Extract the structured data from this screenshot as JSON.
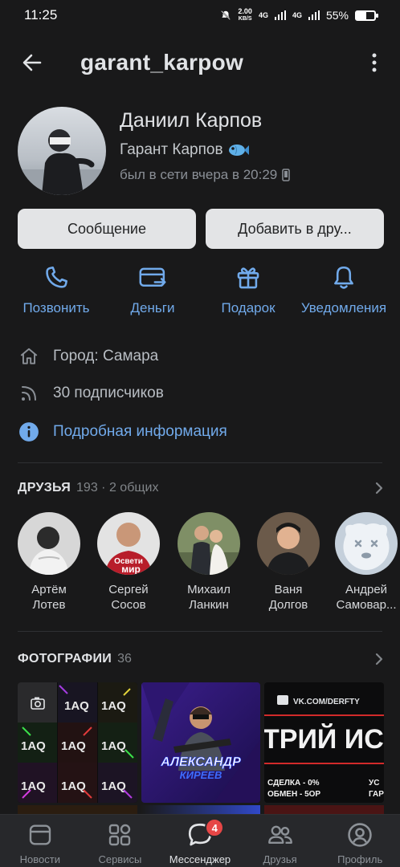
{
  "status_bar": {
    "time": "11:25",
    "speed_value": "2.00",
    "speed_unit": "KB/S",
    "network_1": "4G",
    "network_2": "4G",
    "battery_percent": "55%",
    "battery_level": 0.55
  },
  "header": {
    "title": "garant_karpow"
  },
  "profile": {
    "name": "Даниил Карпов",
    "status": "Гарант Карпов",
    "last_seen": "был в сети вчера в 20:29"
  },
  "buttons": {
    "message": "Сообщение",
    "add_friend": "Добавить в дру..."
  },
  "quick_actions": [
    {
      "label": "Позвонить",
      "icon": "phone-icon"
    },
    {
      "label": "Деньги",
      "icon": "money-card-icon"
    },
    {
      "label": "Подарок",
      "icon": "gift-icon"
    },
    {
      "label": "Уведомления",
      "icon": "bell-icon"
    }
  ],
  "info": {
    "city": "Город: Самара",
    "followers": "30 подписчиков",
    "details_link": "Подробная информация"
  },
  "friends_section": {
    "title": "ДРУЗЬЯ",
    "count": "193 · 2 общих",
    "items": [
      {
        "first": "Артём",
        "last": "Лотев"
      },
      {
        "first": "Сергей",
        "last": "Сосов",
        "avatar_text_1": "Освети",
        "avatar_text_2": "мир"
      },
      {
        "first": "Михаил",
        "last": "Ланкин"
      },
      {
        "first": "Ваня",
        "last": "Долгов"
      },
      {
        "first": "Андрей",
        "last": "Самовар..."
      }
    ]
  },
  "photos_section": {
    "title": "ФОТОГРАФИИ",
    "count": "36",
    "photo1_text": "1AQ",
    "photo2_line1": "АЛЕКСАНДР",
    "photo2_line2": "КИРЕЕВ",
    "photo3_url": "VK.COM/DERFTY",
    "photo3_big": "ТРИЙ ИС",
    "photo3_line1": "СДЕЛКА - 0%",
    "photo3_line2": "ОБМЕН - 5ОР",
    "photo3_side1": "УС",
    "photo3_side2": "ГАР"
  },
  "tabbar": {
    "items": [
      {
        "label": "Новости",
        "icon": "news-icon"
      },
      {
        "label": "Сервисы",
        "icon": "services-icon"
      },
      {
        "label": "Мессенджер",
        "icon": "messenger-icon",
        "badge": "4",
        "active": true
      },
      {
        "label": "Друзья",
        "icon": "friends-icon"
      },
      {
        "label": "Профиль",
        "icon": "profile-icon"
      }
    ]
  },
  "colors": {
    "background": "#19191a",
    "accent": "#71aaeb",
    "button_bg": "#e3e4e6",
    "badge": "#e64646"
  }
}
